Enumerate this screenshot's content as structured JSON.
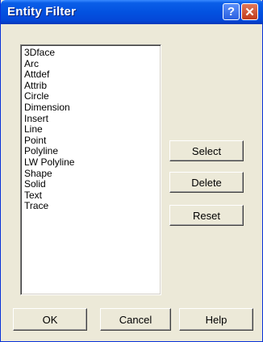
{
  "window": {
    "title": "Entity Filter"
  },
  "titlebar_buttons": {
    "help_label": "?",
    "close_label": "✕"
  },
  "entity_list": [
    "3Dface",
    "Arc",
    "Attdef",
    "Attrib",
    "Circle",
    "Dimension",
    "Insert",
    "Line",
    "Point",
    "Polyline",
    "LW Polyline",
    "Shape",
    "Solid",
    "Text",
    "Trace"
  ],
  "actions": {
    "select_label": "Select",
    "delete_label": "Delete",
    "reset_label": "Reset"
  },
  "footer": {
    "ok_label": "OK",
    "cancel_label": "Cancel",
    "help_label": "Help"
  }
}
